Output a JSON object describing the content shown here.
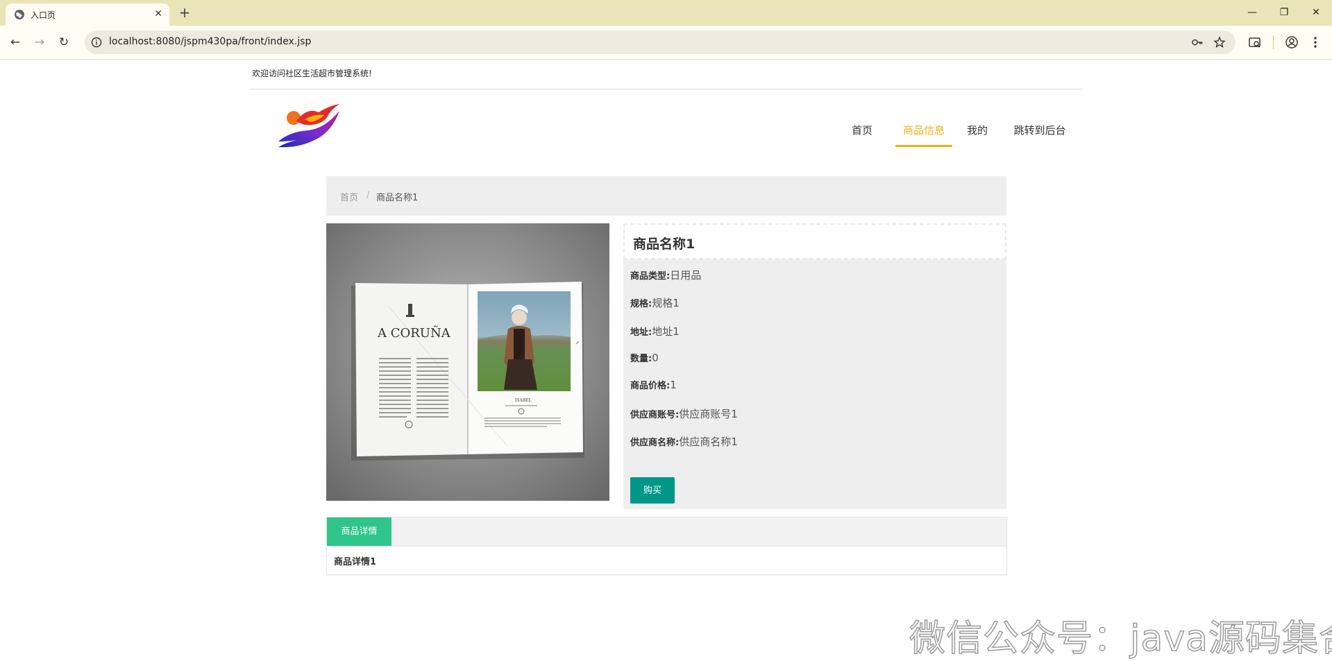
{
  "browser": {
    "tab_title": "入口页",
    "url": "localhost:8080/jspm430pa/front/index.jsp",
    "icons": [
      "globe-icon",
      "close-icon",
      "plus-icon",
      "minimize-icon",
      "restore-icon",
      "close-window-icon",
      "back-icon",
      "forward-icon",
      "reload-icon",
      "site-info-icon",
      "password-key-icon",
      "bookmark-star-icon",
      "tab-search-icon",
      "profile-icon",
      "menu-icon"
    ]
  },
  "header": {
    "welcome": "欢迎访问社区生活超市管理系统!"
  },
  "nav": {
    "items": [
      {
        "label": "首页"
      },
      {
        "label": "商品信息"
      },
      {
        "label": "我的"
      },
      {
        "label": "跳转到后台"
      }
    ],
    "active_index": 1,
    "accent_color": "#e8b213"
  },
  "breadcrumb": {
    "home": "首页",
    "separator": "/",
    "current": "商品名称1"
  },
  "product": {
    "title": "商品名称1",
    "fields": [
      {
        "key": "商品类型:",
        "value": "日用品"
      },
      {
        "key": "规格:",
        "value": "规格1"
      },
      {
        "key": "地址:",
        "value": "地址1"
      },
      {
        "key": "数量:",
        "value": "0"
      },
      {
        "key": "商品价格:",
        "value": "1"
      },
      {
        "key": "供应商账号:",
        "value": "供应商账号1"
      },
      {
        "key": "供应商名称:",
        "value": "供应商名称1"
      }
    ],
    "buy_label": "购买",
    "buy_color": "#009688",
    "image": {
      "magazine_title": "A CORUÑA",
      "caption_name": "ISABEL"
    }
  },
  "detail_tabs": {
    "tab_label": "商品详情",
    "content": "商品详情1",
    "tab_color": "#2fc58b"
  },
  "watermark": "微信公众号：java源码集合"
}
